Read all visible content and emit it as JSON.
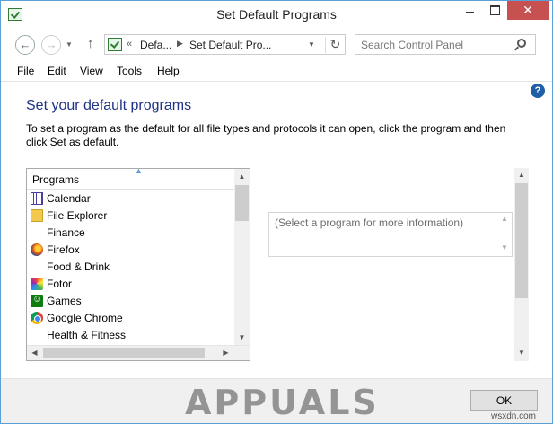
{
  "window": {
    "title": "Set Default Programs",
    "close_glyph": "✕"
  },
  "nav": {
    "back_glyph": "←",
    "forward_glyph": "→",
    "up_glyph": "↑",
    "breadcrumb_lead": "«",
    "breadcrumb": [
      "Defa...",
      "Set Default Pro..."
    ],
    "breadcrumb_sep": "▶",
    "refresh_glyph": "↻",
    "search_placeholder": "Search Control Panel"
  },
  "menu": [
    "File",
    "Edit",
    "View",
    "Tools",
    "Help"
  ],
  "content": {
    "help_glyph": "?",
    "heading": "Set your default programs",
    "description": "To set a program as the default for all file types and protocols it can open, click the program and then click Set as default."
  },
  "programs": {
    "header": "Programs",
    "items": [
      {
        "label": "Calendar",
        "icon": "calendar-icon"
      },
      {
        "label": "File Explorer",
        "icon": "folder-icon"
      },
      {
        "label": "Finance",
        "icon": ""
      },
      {
        "label": "Firefox",
        "icon": "firefox-icon"
      },
      {
        "label": "Food & Drink",
        "icon": ""
      },
      {
        "label": "Fotor",
        "icon": "fotor-icon"
      },
      {
        "label": "Games",
        "icon": "games-icon"
      },
      {
        "label": "Google Chrome",
        "icon": "chrome-icon"
      },
      {
        "label": "Health & Fitness",
        "icon": ""
      }
    ]
  },
  "info_panel": {
    "placeholder": "(Select a program for more information)"
  },
  "footer": {
    "ok_label": "OK",
    "watermark": "APPUALS",
    "source": "wsxdn.com"
  }
}
